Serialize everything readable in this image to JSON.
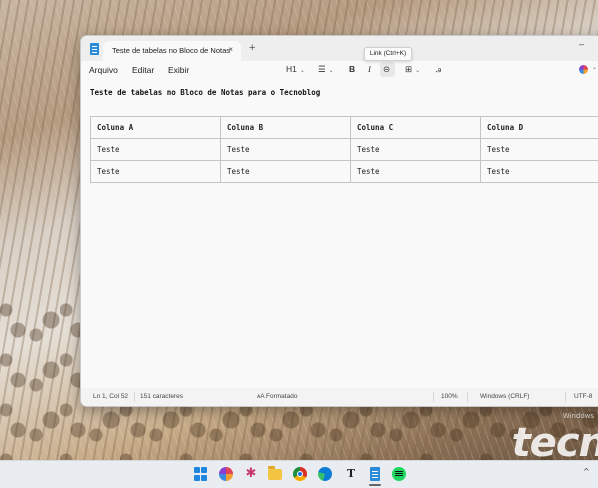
{
  "window": {
    "tab_title": "Teste de tabelas no Bloco de Notas",
    "tab_close": "×",
    "new_tab": "+",
    "minimize": "–",
    "tooltip": "Link (Ctrl+K)"
  },
  "menu": {
    "items": [
      "Arquivo",
      "Editar",
      "Exibir"
    ]
  },
  "toolbar": {
    "heading": "H1",
    "list": "☰",
    "bold": "B",
    "italic": "I",
    "link": "⊝",
    "table": "⊞",
    "spell": "ꭿ",
    "chevron": "⌄"
  },
  "document": {
    "heading": "Teste de tabelas no Bloco de Notas para o Tecnoblog",
    "table": {
      "headers": [
        "Coluna A",
        "Coluna B",
        "Coluna C",
        "Coluna D"
      ],
      "rows": [
        [
          "Teste",
          "Teste",
          "Teste",
          "Teste"
        ],
        [
          "Teste",
          "Teste",
          "Teste",
          "Teste"
        ]
      ]
    }
  },
  "status": {
    "position": "Ln 1, Col 52",
    "chars": "151 caracteres",
    "format": "Formatado",
    "format_icon": "ᴀA",
    "zoom": "100%",
    "line_endings": "Windows (CRLF)",
    "encoding": "UTF-8"
  },
  "wallpaper": {
    "watermark": "tecn",
    "watermark_small": "Windows"
  },
  "taskbar": {
    "icons": [
      "start-icon",
      "copilot-icon",
      "slack-icon",
      "file-explorer-icon",
      "chrome-icon",
      "edge-icon",
      "typora-icon",
      "notepad-icon",
      "spotify-icon"
    ],
    "typora_letter": "T",
    "slack_glyph": "✱",
    "overflow": "^"
  }
}
